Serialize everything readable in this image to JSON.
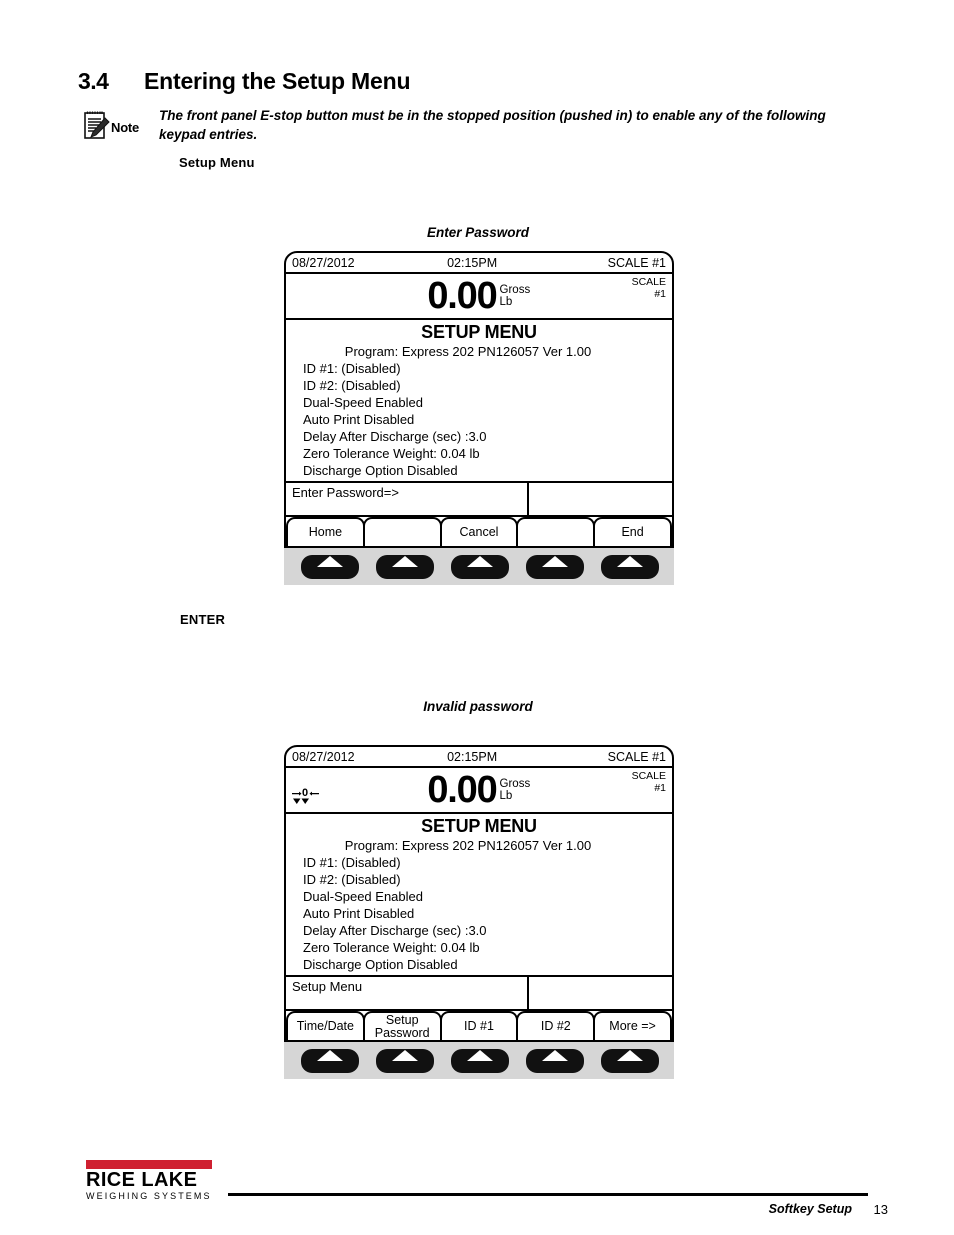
{
  "section": {
    "number": "3.4",
    "title": "Entering the Setup Menu"
  },
  "note": {
    "label": "Note",
    "line1": "The front panel E-stop button must be in the stopped position (pushed in) to enable any of the following",
    "line2": "keypad entries."
  },
  "flow": {
    "setup_menu_label": "Setup Menu",
    "enter_label": "ENTER"
  },
  "panel1": {
    "caption": "Enter Password",
    "top_row": {
      "date": "08/27/2012",
      "time": "02:15PM",
      "scale": "SCALE #1"
    },
    "weight": {
      "value": "0.00",
      "mode": "Gross",
      "units": "Lb",
      "scale_line1": "SCALE",
      "scale_line2": "#1",
      "zero_indicator": false
    },
    "body": {
      "title": "SETUP MENU",
      "subtitle": "Program: Express 202 PN126057 Ver 1.00",
      "lines": [
        "ID #1: (Disabled)",
        "ID #2: (Disabled)",
        "Dual-Speed Enabled",
        "Auto Print Disabled",
        "Delay After Discharge (sec) :3.0",
        "Zero Tolerance Weight: 0.04 lb",
        "Discharge Option Disabled"
      ]
    },
    "status": "Enter Password=>",
    "softkeys": [
      "Home",
      "",
      "Cancel",
      "",
      "End"
    ]
  },
  "panel2": {
    "caption": "Invalid password",
    "top_row": {
      "date": "08/27/2012",
      "time": "02:15PM",
      "scale": "SCALE #1"
    },
    "weight": {
      "value": "0.00",
      "mode": "Gross",
      "units": "Lb",
      "scale_line1": "SCALE",
      "scale_line2": "#1",
      "zero_indicator": true
    },
    "body": {
      "title": "SETUP MENU",
      "subtitle": "Program: Express 202 PN126057 Ver 1.00",
      "lines": [
        "ID #1: (Disabled)",
        "ID #2: (Disabled)",
        "Dual-Speed Enabled",
        "Auto Print Disabled",
        "Delay After Discharge (sec) :3.0",
        "Zero Tolerance Weight: 0.04 lb",
        "Discharge Option Disabled"
      ]
    },
    "status": "Setup Menu",
    "softkeys": [
      "Time/Date",
      "Setup\nPassword",
      "ID #1",
      "ID #2",
      "More =>"
    ]
  },
  "footer": {
    "logo_name": "RICE LAKE",
    "logo_sub": "WEIGHING SYSTEMS",
    "logo_color": "#cf2031",
    "section_name": "Softkey Setup",
    "page_number": "13"
  }
}
